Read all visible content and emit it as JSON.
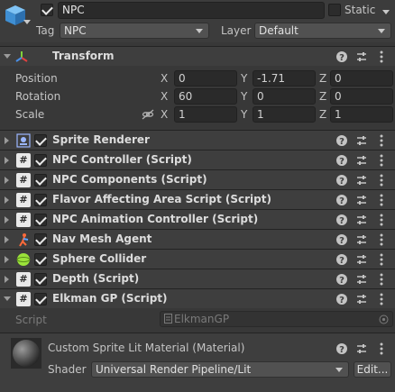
{
  "header": {
    "object_name": "NPC",
    "static_label": "Static",
    "tag_label": "Tag",
    "tag_value": "NPC",
    "layer_label": "Layer",
    "layer_value": "Default"
  },
  "transform": {
    "title": "Transform",
    "rows": [
      {
        "label": "Position",
        "x": "0",
        "y": "-1.71",
        "z": "0"
      },
      {
        "label": "Rotation",
        "x": "60",
        "y": "0",
        "z": "0"
      },
      {
        "label": "Scale",
        "x": "1",
        "y": "1",
        "z": "1"
      }
    ],
    "axis_x": "X",
    "axis_y": "Y",
    "axis_z": "Z"
  },
  "components": [
    {
      "title": "Sprite Renderer",
      "icon": "sprite-renderer-icon"
    },
    {
      "title": "NPC Controller (Script)",
      "icon": "script-icon"
    },
    {
      "title": "NPC Components (Script)",
      "icon": "script-icon"
    },
    {
      "title": "Flavor Affecting Area Script (Script)",
      "icon": "script-icon"
    },
    {
      "title": "NPC Animation Controller (Script)",
      "icon": "script-icon"
    },
    {
      "title": "Nav Mesh Agent",
      "icon": "nav-mesh-agent-icon"
    },
    {
      "title": "Sphere Collider",
      "icon": "sphere-collider-icon"
    },
    {
      "title": "Depth (Script)",
      "icon": "script-icon"
    },
    {
      "title": "Elkman GP (Script)",
      "icon": "script-icon"
    }
  ],
  "script_field": {
    "label": "Script",
    "value": "ElkmanGP"
  },
  "material": {
    "title": "Custom Sprite Lit Material (Material)",
    "shader_label": "Shader",
    "shader_value": "Universal Render Pipeline/Lit",
    "edit_label": "Edit..."
  },
  "icon_glyphs": {
    "help": "❓",
    "menu": "⋮"
  },
  "colors": {
    "background": "#383838",
    "header_bg": "#3e3e3e",
    "field_bg": "#2a2a2a",
    "text": "#c4c4c4",
    "transform_axis_red": "#e04040",
    "transform_axis_green": "#7fd13b",
    "transform_axis_blue": "#4a8fe7",
    "sphere_green": "#9be33a"
  }
}
